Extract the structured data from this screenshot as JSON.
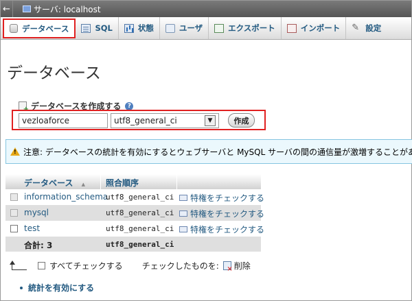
{
  "server_bar": {
    "title": "サーバ: localhost"
  },
  "tabs": [
    {
      "label": "データベース",
      "icon": "database-icon",
      "active": true
    },
    {
      "label": "SQL",
      "icon": "sql-icon"
    },
    {
      "label": "状態",
      "icon": "status-icon"
    },
    {
      "label": "ユーザ",
      "icon": "users-icon"
    },
    {
      "label": "エクスポート",
      "icon": "export-icon"
    },
    {
      "label": "インポート",
      "icon": "import-icon"
    },
    {
      "label": "設定",
      "icon": "settings-icon"
    }
  ],
  "page_title": "データベース",
  "create_db": {
    "label": "データベースを作成する",
    "name_value": "vezloaforce",
    "collation_value": "utf8_general_ci",
    "button_label": "作成"
  },
  "notice": {
    "text": "注意: データベースの統計を有効にするとウェブサーバと MySQL サーバの間の通信量が激増することがあります。"
  },
  "table": {
    "headers": {
      "database": "データベース",
      "sort_indicator": "▲",
      "collation": "照合順序"
    },
    "rows": [
      {
        "name": "information_schema",
        "collation": "utf8_general_ci",
        "action": "特権をチェックする",
        "checkbox_disabled": true
      },
      {
        "name": "mysql",
        "collation": "utf8_general_ci",
        "action": "特権をチェックする",
        "checkbox_disabled": true
      },
      {
        "name": "test",
        "collation": "utf8_general_ci",
        "action": "特権をチェックする",
        "checkbox_disabled": false
      }
    ],
    "footer": {
      "label": "合計: 3",
      "collation": "utf8_general_ci"
    }
  },
  "bottom": {
    "check_all_label": "すべてチェックする",
    "with_selected_label": "チェックしたものを:",
    "delete_label": "削除"
  },
  "enable_stats_label": "統計を有効にする",
  "colors": {
    "link": "#235a81",
    "highlight_border": "#e02020",
    "notice_bg": "#ebf8fd"
  }
}
